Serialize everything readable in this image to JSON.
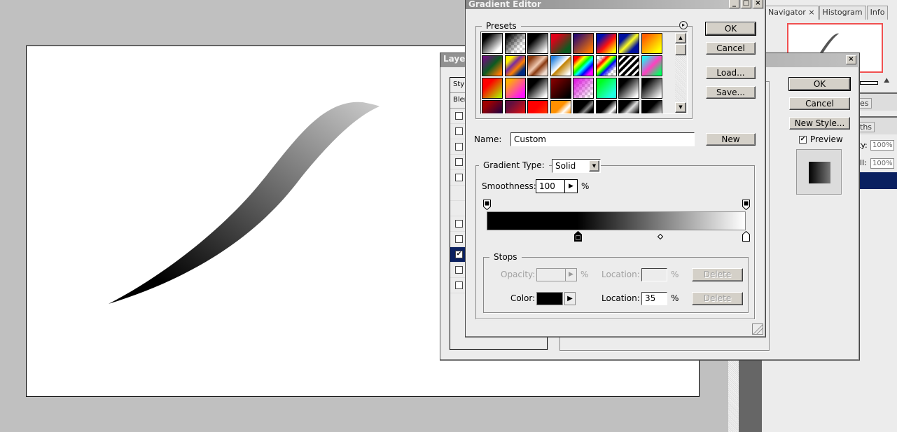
{
  "right_panel": {
    "tabs": [
      {
        "label": "Navigator ×",
        "active": true
      },
      {
        "label": "Histogram",
        "active": false
      },
      {
        "label": "Info",
        "active": false
      }
    ],
    "tab_fragments": [
      "es",
      "ths"
    ],
    "opacity_label_fragment": "ty:",
    "opacity_value": "100%",
    "fill_label_fragment": "ill:",
    "fill_value": "100%",
    "nav_view_color": "#f05050"
  },
  "layer_style": {
    "title": "Layer Style",
    "title_fragment": "Layer",
    "list_header_fragments": [
      "Styl",
      "Bler"
    ],
    "items": [
      {
        "checked": false
      },
      {
        "checked": false
      },
      {
        "checked": false
      },
      {
        "checked": false
      },
      {
        "checked": false
      },
      {
        "checked": null
      },
      {
        "checked": null
      },
      {
        "checked": false
      },
      {
        "checked": false
      },
      {
        "checked": true,
        "selected": true
      },
      {
        "checked": false
      },
      {
        "checked": false
      }
    ],
    "ok_label": "OK",
    "cancel_label": "Cancel",
    "new_style_label": "New Style...",
    "preview_label": "Preview",
    "preview_checked": true,
    "close_icon": "×"
  },
  "gradient_editor": {
    "title": "Gradient Editor",
    "window_buttons": [
      "_",
      "□",
      "×"
    ],
    "presets_label": "Presets",
    "presets_menu_icon": "▸",
    "presets": [
      [
        "linear-gradient(135deg,#000 20%,#fff 80%)",
        "linear-gradient(135deg,#000 10%,transparent 70%)",
        "linear-gradient(135deg,#000 30%,#fff 90%)",
        "linear-gradient(135deg,#e00018 20%,#0c5a20 80%)",
        "linear-gradient(135deg,#2a0a70 10%,#ff7a00 90%)",
        "linear-gradient(135deg,#0010b0 20%,#ff1010 55%,#ffff00 90%)",
        "linear-gradient(135deg,#0010a0 25%,#ffff20 50%,#0010a0 75%)",
        "linear-gradient(135deg,#ff6000 15%,#ffff00 85%)"
      ],
      [
        "linear-gradient(135deg,#6a107a 10%,#0c5a20 50%,#ff7800 90%)",
        "linear-gradient(135deg,#ffee00 20%,#7a2aa0 40%,#ff8000 60%,#002a80 80%)",
        "linear-gradient(135deg,#8a3a10 15%,#f0c8b0 45%,#8a3a10 60%,#f0dcd0 85%)",
        "linear-gradient(135deg,#2080e0 10%,#fff 48%,#c08000 52%,#fff 90%)",
        "linear-gradient(135deg,#ff0000 15%,#ffff00 30%,#00ff00 45%,#00ffff 55%,#0000ff 70%,#ff00ff 85%)",
        "linear-gradient(135deg,transparent 15%,#ff0000 30%,#ffff00 40%,#00ff00 50%,#0000ff 60%,transparent 80%)",
        "repeating-linear-gradient(135deg,#000 0 4px,#fff 4px 7px)",
        "linear-gradient(135deg,#20f0f0 10%,#ff40c0 50%,#00ff60 90%)"
      ],
      [
        "linear-gradient(135deg,#ff0000 30%,#b0e000 90%)",
        "linear-gradient(135deg,#ffb000 15%,#ff10ff 85%)",
        "linear-gradient(135deg,#000 30%,#fff 90%)",
        "linear-gradient(135deg,#800000 10%,#000 90%)",
        "linear-gradient(135deg,#e020e0 10%,transparent 90%)",
        "linear-gradient(135deg,#00ff20 20%,#20ffe0 80%)",
        "linear-gradient(135deg,#000 25%,#fff 90%)",
        "linear-gradient(135deg,#000 20%,#fff 95%)"
      ],
      [
        "linear-gradient(135deg,#a00000 20%,#200040 80%)",
        "linear-gradient(135deg,#601040 20%,#e01010 80%)",
        "linear-gradient(135deg,#ff0000 40%,#ff4000 90%)",
        "linear-gradient(135deg,#ff9000 40%,#fff 60%,#ff9000 80%)",
        "linear-gradient(135deg,#000 40%,#888 55%,#000 70%)",
        "linear-gradient(135deg,#000 40%,#fff 65%,#000 85%)",
        "linear-gradient(135deg,#000 30%,#ddd 50%,#000 80%)",
        "linear-gradient(135deg,#000 40%,#fff 90%)"
      ]
    ],
    "ok_label": "OK",
    "cancel_label": "Cancel",
    "load_label": "Load...",
    "save_label": "Save...",
    "name_label": "Name:",
    "name_value": "Custom",
    "new_label": "New",
    "gradient_type_label": "Gradient Type:",
    "gradient_type_value": "Solid",
    "smoothness_label": "Smoothness:",
    "smoothness_value": "100",
    "percent": "%",
    "opacity_stops": [
      {
        "location": 0,
        "opacity": 100
      },
      {
        "location": 100,
        "opacity": 100
      }
    ],
    "color_stops": [
      {
        "location": 35,
        "color": "#000000",
        "selected": true
      },
      {
        "location": 100,
        "color": "#ffffff",
        "selected": false
      }
    ],
    "midpoint": 67,
    "stops_label": "Stops",
    "opacity_label": "Opacity:",
    "opacity_value": "",
    "location_label": "Location:",
    "opacity_location_value": "",
    "delete_label": "Delete",
    "color_label": "Color:",
    "color_value": "#000000",
    "color_location_value": "35"
  }
}
